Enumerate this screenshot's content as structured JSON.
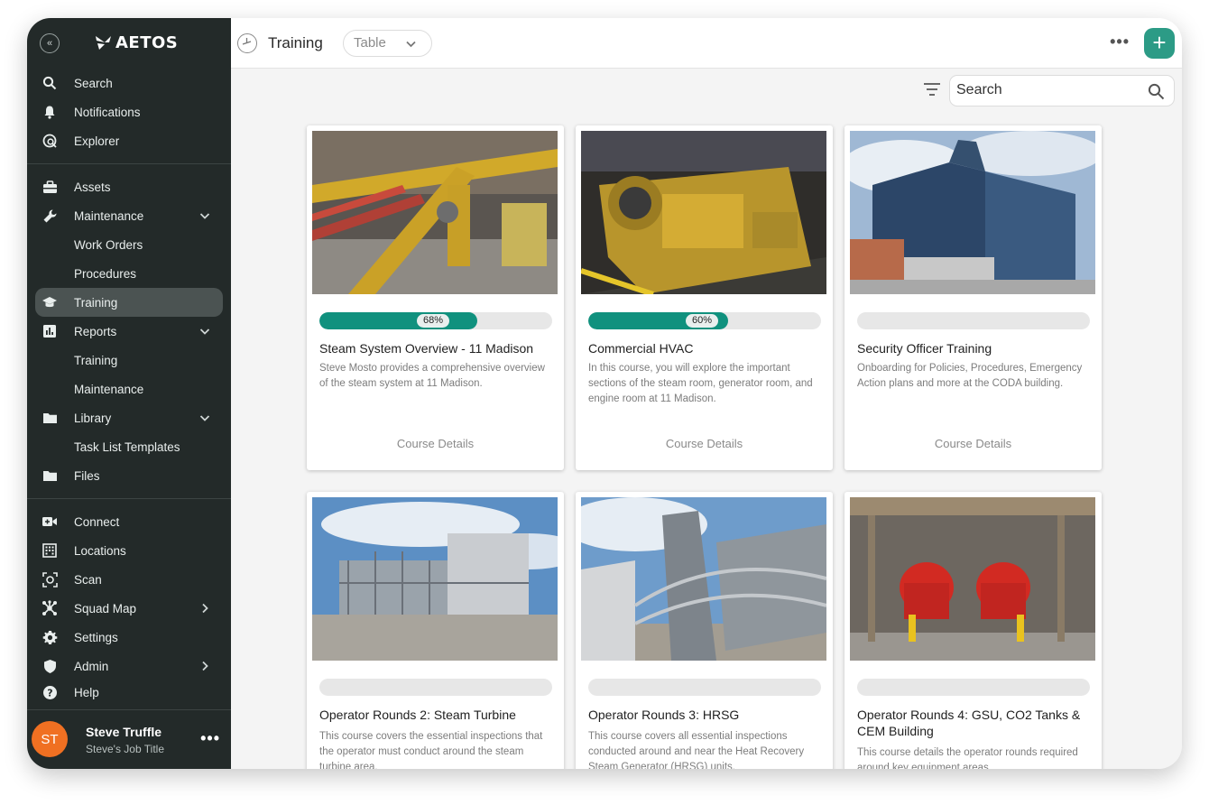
{
  "app": {
    "brand": "AETOS",
    "accent": "#2c9b86"
  },
  "sidebar": {
    "primary": [
      {
        "label": "Search",
        "icon": "search-icon"
      },
      {
        "label": "Notifications",
        "icon": "bell-icon"
      },
      {
        "label": "Explorer",
        "icon": "explorer-icon"
      }
    ],
    "modules": [
      {
        "label": "Assets",
        "icon": "briefcase-icon"
      },
      {
        "label": "Maintenance",
        "icon": "wrench-icon"
      },
      {
        "label": "Work Orders"
      },
      {
        "label": "Procedures"
      },
      {
        "label": "Training",
        "icon": "graduation-cap-icon"
      },
      {
        "label": "Reports",
        "icon": "chart-icon"
      },
      {
        "label": "Training"
      },
      {
        "label": "Maintenance"
      },
      {
        "label": "Library",
        "icon": "folder-icon"
      },
      {
        "label": "Task List Templates"
      },
      {
        "label": "Files",
        "icon": "folder-icon"
      }
    ],
    "tools": [
      {
        "label": "Connect",
        "icon": "video-icon"
      },
      {
        "label": "Locations",
        "icon": "building-icon"
      },
      {
        "label": "Scan",
        "icon": "scan-icon"
      },
      {
        "label": "Squad Map",
        "icon": "network-icon"
      },
      {
        "label": "Settings",
        "icon": "gear-icon"
      },
      {
        "label": "Admin",
        "icon": "shield-icon"
      },
      {
        "label": "Help",
        "icon": "help-icon"
      }
    ],
    "user": {
      "initials": "ST",
      "name": "Steve Truffle",
      "title": "Steve's Job Title"
    }
  },
  "header": {
    "title": "Training",
    "view": "Table"
  },
  "toolbar": {
    "search_placeholder": "Search"
  },
  "courses": [
    {
      "title": "Steam System Overview - 11 Madison",
      "desc": "Steve Mosto provides a comprehensive overview of the steam system at 11 Madison.",
      "progress_label": "68%",
      "progress": 0.68,
      "link": "Course Details"
    },
    {
      "title": "Commercial HVAC",
      "desc": "In this course, you will explore the important sections of the steam room, generator room, and engine room at 11 Madison.",
      "progress_label": "60%",
      "progress": 0.6,
      "link": "Course Details"
    },
    {
      "title": "Security Officer Training",
      "desc": "Onboarding for Policies, Procedures, Emergency Action plans and more at the CODA building.",
      "progress_label": "",
      "progress": 0,
      "link": "Course Details"
    },
    {
      "title": "Operator Rounds 2: Steam Turbine",
      "desc": "This course covers the essential inspections that the operator must conduct around the steam turbine area.",
      "progress_label": "",
      "progress": 0,
      "link": ""
    },
    {
      "title": "Operator Rounds 3: HRSG",
      "desc": "This course covers all essential inspections conducted around and near the Heat Recovery Steam Generator (HRSG) units.",
      "progress_label": "",
      "progress": 0,
      "link": ""
    },
    {
      "title": "Operator Rounds 4: GSU, CO2 Tanks & CEM Building",
      "desc": "This course details the operator rounds required around key equipment areas.",
      "progress_label": "",
      "progress": 0,
      "link": ""
    }
  ]
}
